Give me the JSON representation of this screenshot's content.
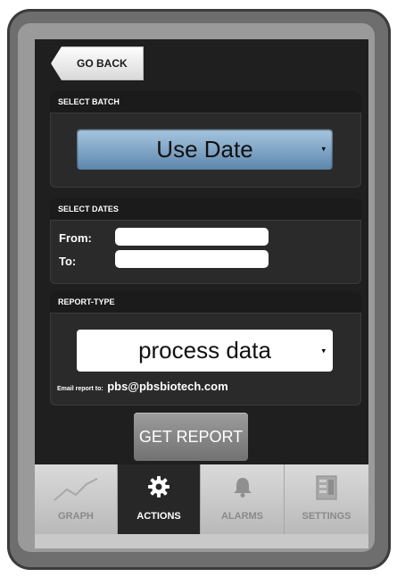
{
  "header": {
    "back_label": "GO BACK"
  },
  "select_batch": {
    "title": "SELECT BATCH",
    "selected": "Use Date"
  },
  "select_dates": {
    "title": "SELECT DATES",
    "from_label": "From:",
    "to_label": "To:",
    "from_value": "",
    "to_value": ""
  },
  "report_type": {
    "title": "REPORT-TYPE",
    "selected": "process data",
    "email_prefix": "Email report to:",
    "email": "pbs@pbsbiotech.com"
  },
  "actions": {
    "get_report_label": "GET REPORT"
  },
  "tabs": [
    {
      "label": "GRAPH",
      "icon": "graph-icon",
      "active": false
    },
    {
      "label": "ACTIONS",
      "icon": "gear-icon",
      "active": true
    },
    {
      "label": "ALARMS",
      "icon": "bell-icon",
      "active": false
    },
    {
      "label": "SETTINGS",
      "icon": "settings-panel-icon",
      "active": false
    }
  ],
  "colors": {
    "screen_bg": "#1f1f1f",
    "panel_bg": "#2a2a2a",
    "accent_blue": "#7ea6c8",
    "button_gray": "#868686"
  }
}
